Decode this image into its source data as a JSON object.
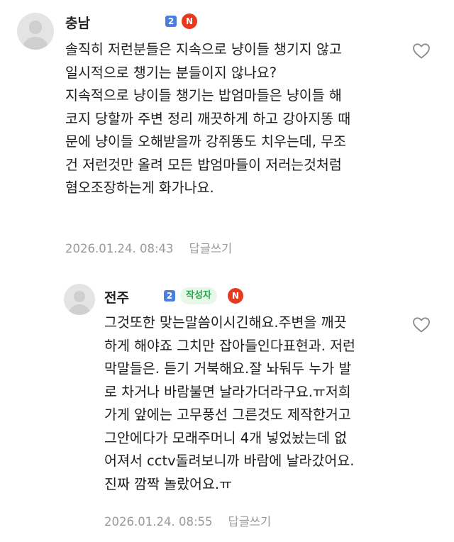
{
  "comments": [
    {
      "username": "충남",
      "grade_badge": "2",
      "new_badge": "N",
      "author_badge": "",
      "text": "솔직히 저런분들은 지속으로 냥이들 챙기지 않고\n일시적으로 챙기는 분들이지 않나요?\n지속적으로 냥이들 챙기는 밥엄마들은 냥이들 해\n코지 당할까 주변 정리 깨끗하게 하고 강아지똥 때\n문에 냥이들 오해받을까 강쥐똥도 치우는데, 무조\n건 저런것만 올려 모든 밥엄마들이 저러는것처럼\n혐오조장하는게 화가나요.",
      "timestamp": "2026.01.24. 08:43",
      "reply_label": "답글쓰기",
      "like_icon": "heart-outline"
    },
    {
      "username": "전주",
      "grade_badge": "2",
      "new_badge": "N",
      "author_badge": "작성자",
      "text": "그것또한 맞는말씀이시긴해요.주변을 깨끗\n하게 해야죠 그치만 잡아들인다표현과. 저런\n막말들은. 듣기 거북해요.잘 놔둬두 누가 발\n로 차거나 바람불면 날라가더라구요.ㅠ저희\n가게 앞에는 고무풍선 그른것도 제작한거고\n그안에다가 모래주머니 4개 넣었놨는데 없\n어져서 cctv돌려보니까 바람에 날라갔어요.\n진짜 깜짝 놀랐어요.ㅠ",
      "timestamp": "2026.01.24. 08:55",
      "reply_label": "답글쓰기",
      "like_icon": "heart-outline"
    }
  ],
  "colors": {
    "grade_badge": "#4a7fe0",
    "new_badge": "#e8391f",
    "author_badge_bg": "#e8f7ea",
    "author_badge_text": "#21a84a",
    "meta_text": "#9a9a9a"
  }
}
